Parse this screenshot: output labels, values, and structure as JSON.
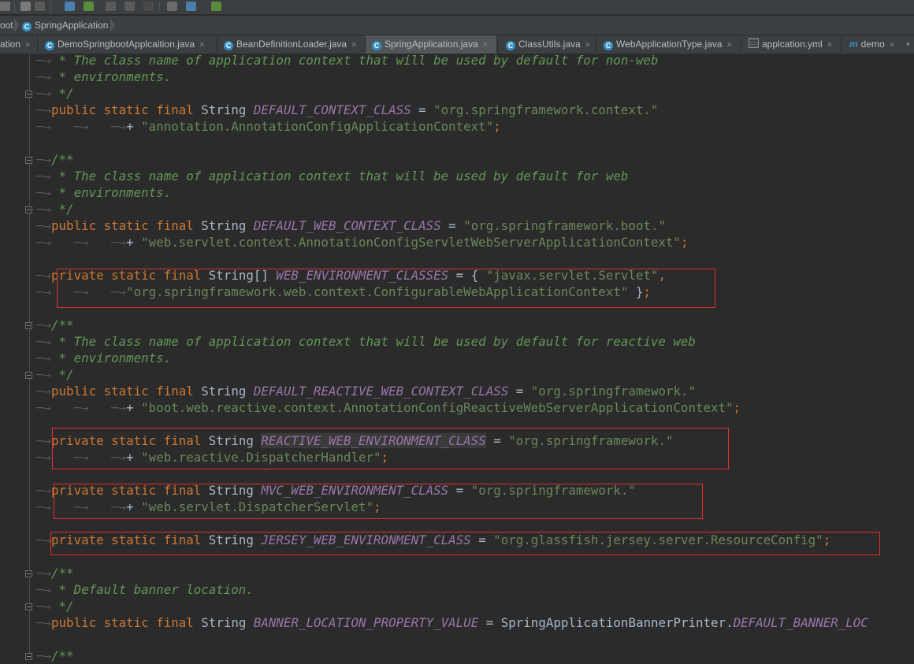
{
  "breadcrumb": {
    "items": [
      "oot",
      "SpringApplication"
    ]
  },
  "tabs": [
    {
      "label": "ation",
      "icon": "none"
    },
    {
      "label": "DemoSpringbootApplcaition.java",
      "icon": "class-icon"
    },
    {
      "label": "BeanDefinitionLoader.java",
      "icon": "class-icon"
    },
    {
      "label": "SpringApplication.java",
      "icon": "class-icon",
      "active": true
    },
    {
      "label": "ClassUtils.java",
      "icon": "class-icon"
    },
    {
      "label": "WebApplicationType.java",
      "icon": "class-icon"
    },
    {
      "label": "applcation.yml",
      "icon": "yml-icon"
    },
    {
      "label": "demo",
      "icon": "maven-icon"
    }
  ],
  "tab_close": "×",
  "code": {
    "kw_public": "public",
    "kw_private": "private",
    "kw_static": "static",
    "kw_final": "final",
    "t_string": "String",
    "t_string_arr": "String[]",
    "comment_open": "/**",
    "comment_close": "*/",
    "c1a": "* The class name of application context that will be used by default for non-web",
    "c1b": "* environments.",
    "const1": "DEFAULT_CONTEXT_CLASS",
    "s1a": "\"org.springframework.context.\"",
    "s1b": "\"annotation.AnnotationConfigApplicationContext\"",
    "c2a": "* The class name of application context that will be used by default for web",
    "c2b": "* environments.",
    "const2": "DEFAULT_WEB_CONTEXT_CLASS",
    "s2a": "\"org.springframework.boot.\"",
    "s2b": "\"web.servlet.context.AnnotationConfigServletWebServerApplicationContext\"",
    "const3": "WEB_ENVIRONMENT_CLASSES",
    "s3a": "\"javax.servlet.Servlet\"",
    "s3b": "\"org.springframework.web.context.ConfigurableWebApplicationContext\"",
    "c3a": "* The class name of application context that will be used by default for reactive web",
    "c3b": "* environments.",
    "const4": "DEFAULT_REACTIVE_WEB_CONTEXT_CLASS",
    "s4a": "\"org.springframework.\"",
    "s4b": "\"boot.web.reactive.context.AnnotationConfigReactiveWebServerApplicationContext\"",
    "const5": "REACTIVE_WEB_ENVIRONMENT_CLASS",
    "s5a": "\"org.springframework.\"",
    "s5b": "\"web.reactive.DispatcherHandler\"",
    "const6": "MVC_WEB_ENVIRONMENT_CLASS",
    "s6a": "\"org.springframework.\"",
    "s6b": "\"web.servlet.DispatcherServlet\"",
    "const7": "JERSEY_WEB_ENVIRONMENT_CLASS",
    "s7a": "\"org.glassfish.jersey.server.ResourceConfig\"",
    "c4a": "* Default banner location.",
    "const8": "BANNER_LOCATION_PROPERTY_VALUE",
    "ref8": "SpringApplicationBannerPrinter.",
    "const8b": "DEFAULT_BANNER_LOC"
  },
  "colors": {
    "keyword": "#cc7832",
    "string": "#6a8759",
    "constant": "#9876aa",
    "comment": "#629755",
    "highlight_box": "#e03030"
  }
}
